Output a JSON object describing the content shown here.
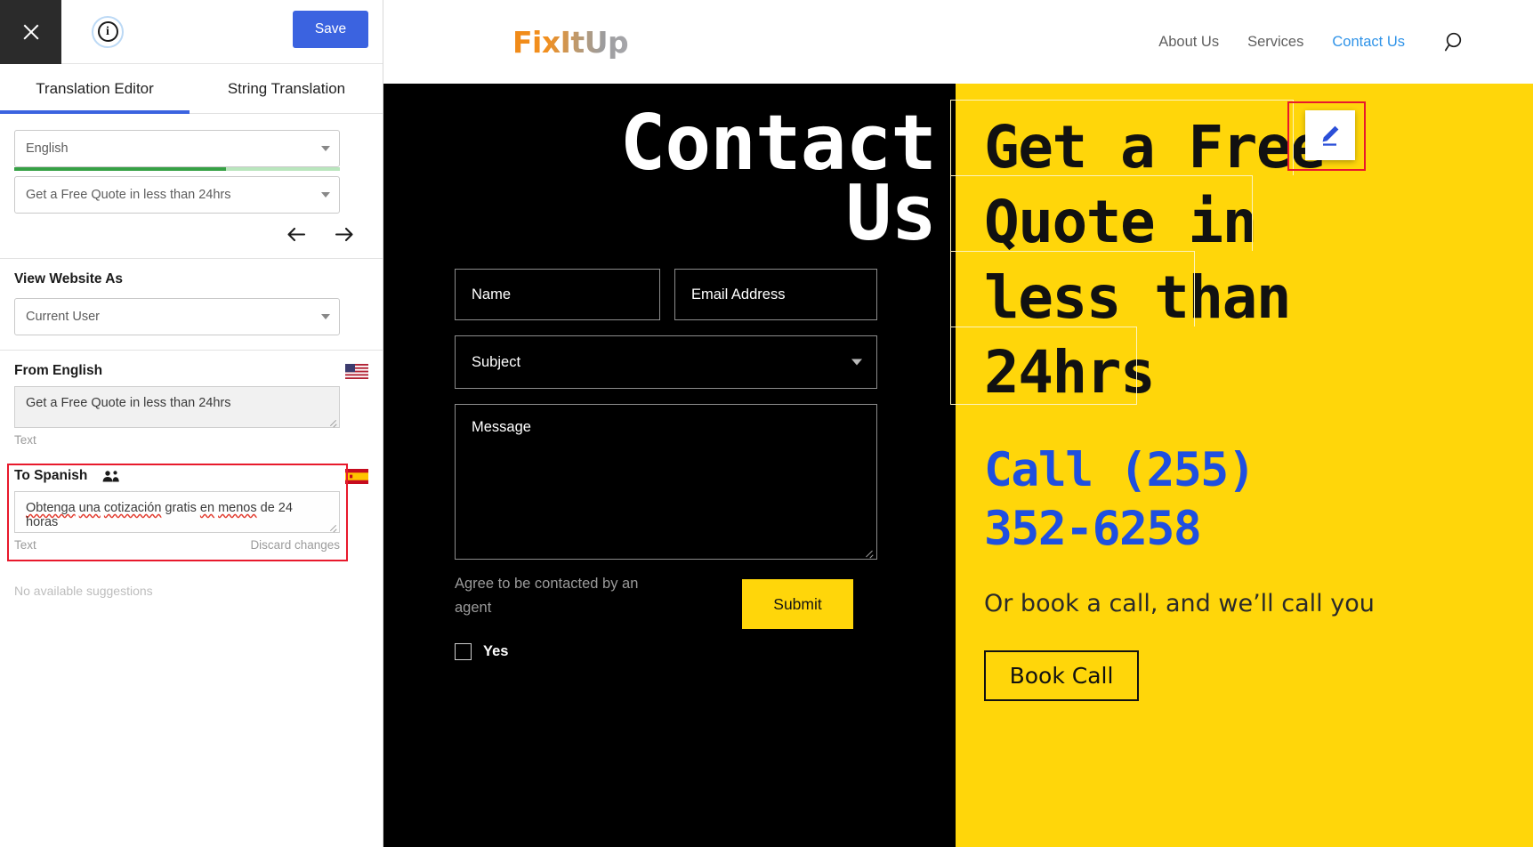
{
  "panel": {
    "close_label": "Close",
    "info_label": "i",
    "save_label": "Save",
    "tabs": [
      {
        "label": "Translation Editor",
        "active": true
      },
      {
        "label": "String Translation",
        "active": false
      }
    ],
    "language_select": {
      "value": "English",
      "progress_percent": 65
    },
    "string_select": {
      "value": "Get a Free Quote in less than 24hrs"
    },
    "undo_label": "Undo",
    "redo_label": "Redo",
    "view_website_as": {
      "title": "View Website As",
      "value": "Current User"
    },
    "source": {
      "title": "From English",
      "flag": "us-flag",
      "text": "Get a Free Quote in less than 24hrs",
      "type_label": "Text"
    },
    "target": {
      "title": "To Spanish",
      "people_icon": "people-icon",
      "flag": "es-flag",
      "text_parts": [
        {
          "t": "Obtenga",
          "spell": true
        },
        {
          "t": " ",
          "spell": false
        },
        {
          "t": "una",
          "spell": true
        },
        {
          "t": " ",
          "spell": false
        },
        {
          "t": "cotización",
          "spell": true
        },
        {
          "t": " gratis ",
          "spell": false
        },
        {
          "t": "en",
          "spell": true
        },
        {
          "t": " ",
          "spell": false
        },
        {
          "t": "menos",
          "spell": true
        },
        {
          "t": " de 24 horas",
          "spell": false
        }
      ],
      "text": "Obtenga una cotización gratis en menos de 24 horas",
      "type_label": "Text",
      "discard_label": "Discard changes"
    },
    "suggestions_empty": "No available suggestions"
  },
  "site": {
    "logo": "FixItUp",
    "nav": [
      {
        "label": "About Us",
        "active": false
      },
      {
        "label": "Services",
        "active": false
      },
      {
        "label": "Contact Us",
        "active": true
      }
    ],
    "search_icon": "search-icon",
    "heading": "Contact\nUs",
    "form": {
      "name_placeholder": "Name",
      "email_placeholder": "Email Address",
      "subject_placeholder": "Subject",
      "message_placeholder": "Message",
      "agree_label": "Agree to be contacted by an agent",
      "yes_label": "Yes",
      "submit_label": "Submit"
    },
    "hero": {
      "headline": "Get a Free Quote in less than 24hrs",
      "phone": "Call (255) 352-6258",
      "book_text": "Or book a call, and we’ll call you",
      "book_button": "Book Call"
    },
    "edit_button": "edit-pencil-icon"
  },
  "colors": {
    "accent_blue": "#3b63e0",
    "brand_yellow": "#FFD60A",
    "phone_blue": "#1f4fe0",
    "highlight_red": "#e8192c",
    "progress_green": "#36a145",
    "nav_active": "#2f93e8"
  }
}
